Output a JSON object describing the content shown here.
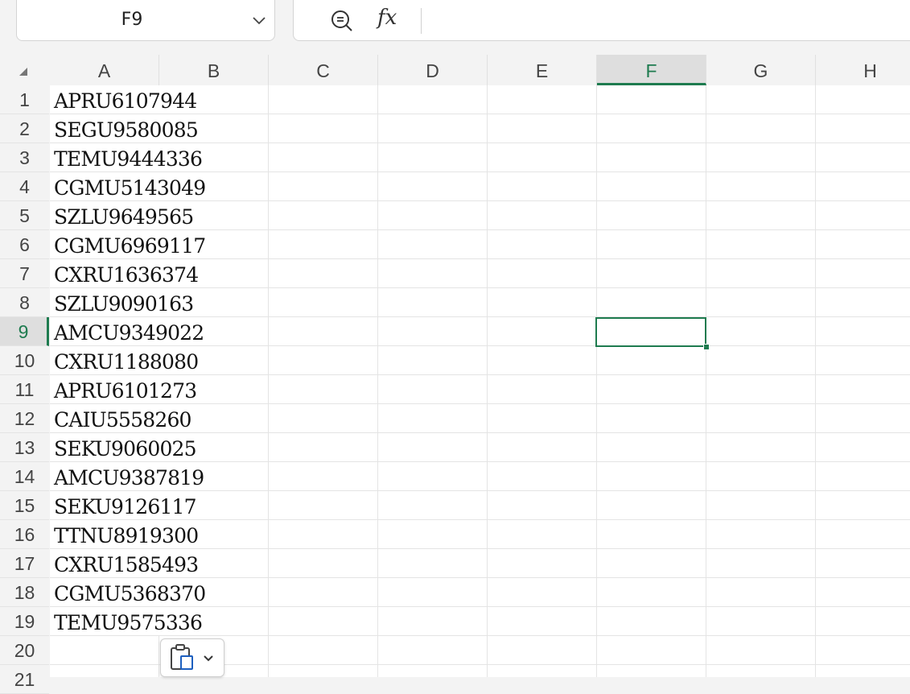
{
  "name_box": {
    "value": "F9"
  },
  "formula_bar": {
    "fx_label": "fx",
    "value": ""
  },
  "columns": [
    "A",
    "B",
    "C",
    "D",
    "E",
    "F",
    "G",
    "H"
  ],
  "selected_column": "F",
  "selected_row": "9",
  "rows": [
    "1",
    "2",
    "3",
    "4",
    "5",
    "6",
    "7",
    "8",
    "9",
    "10",
    "11",
    "12",
    "13",
    "14",
    "15",
    "16",
    "17",
    "18",
    "19",
    "20",
    "21"
  ],
  "column_a_values": [
    "APRU6107944",
    "SEGU9580085",
    "TEMU9444336",
    "CGMU5143049",
    "SZLU9649565",
    "CGMU6969117",
    "CXRU1636374",
    "SZLU9090163",
    "AMCU9349022",
    "CXRU1188080",
    "APRU6101273",
    "CAIU5558260",
    "SEKU9060025",
    "AMCU9387819",
    "SEKU9126117",
    "TTNU8919300",
    "CXRU1585493",
    "CGMU5368370",
    "TEMU9575336"
  ],
  "icons": {
    "zoom": "zoom-out-icon",
    "chevron": "chevron-down-icon",
    "paste": "paste-options-icon",
    "select_all": "select-all-triangle-icon"
  },
  "colors": {
    "accent": "#1e7b4f",
    "header_bg": "#f3f3f3",
    "selected_header_bg": "#dedede"
  }
}
